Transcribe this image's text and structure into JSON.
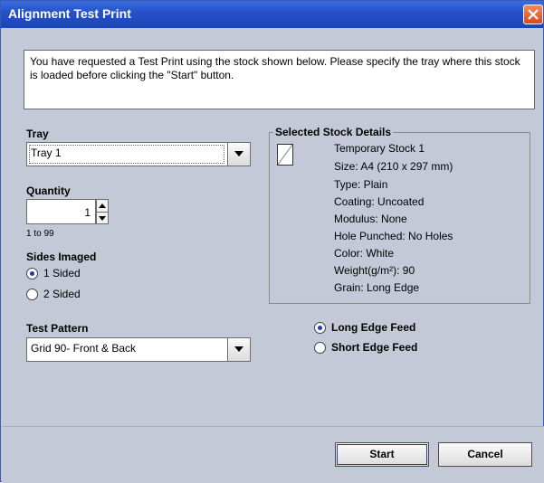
{
  "window": {
    "title": "Alignment Test Print",
    "close_icon": "close-icon"
  },
  "message": "You have requested a Test Print using the stock shown below.  Please specify the tray where this stock is loaded before clicking the \"Start\" button.",
  "tray": {
    "label": "Tray",
    "selected": "Tray 1"
  },
  "quantity": {
    "label": "Quantity",
    "value": "1",
    "range_hint": "1 to 99"
  },
  "sides_imaged": {
    "label": "Sides Imaged",
    "options": [
      {
        "label": "1 Sided",
        "selected": true
      },
      {
        "label": "2 Sided",
        "selected": false
      }
    ]
  },
  "test_pattern": {
    "label": "Test Pattern",
    "selected": "Grid 90- Front & Back"
  },
  "stock_details": {
    "label": "Selected Stock Details",
    "icon": "document-icon",
    "lines": [
      "Temporary Stock 1",
      "Size: A4 (210 x 297 mm)",
      "Type: Plain",
      "Coating: Uncoated",
      "Modulus: None",
      "Hole Punched: No Holes",
      "Color: White",
      "Weight(g/m²): 90",
      "Grain: Long Edge"
    ]
  },
  "feed": {
    "options": [
      {
        "label": "Long Edge Feed",
        "selected": true
      },
      {
        "label": "Short Edge Feed",
        "selected": false
      }
    ]
  },
  "buttons": {
    "start": "Start",
    "cancel": "Cancel"
  },
  "colors": {
    "titlebar": "#2552c9",
    "dialog_bg": "#c3c9d6",
    "close_button": "#d9481c"
  }
}
